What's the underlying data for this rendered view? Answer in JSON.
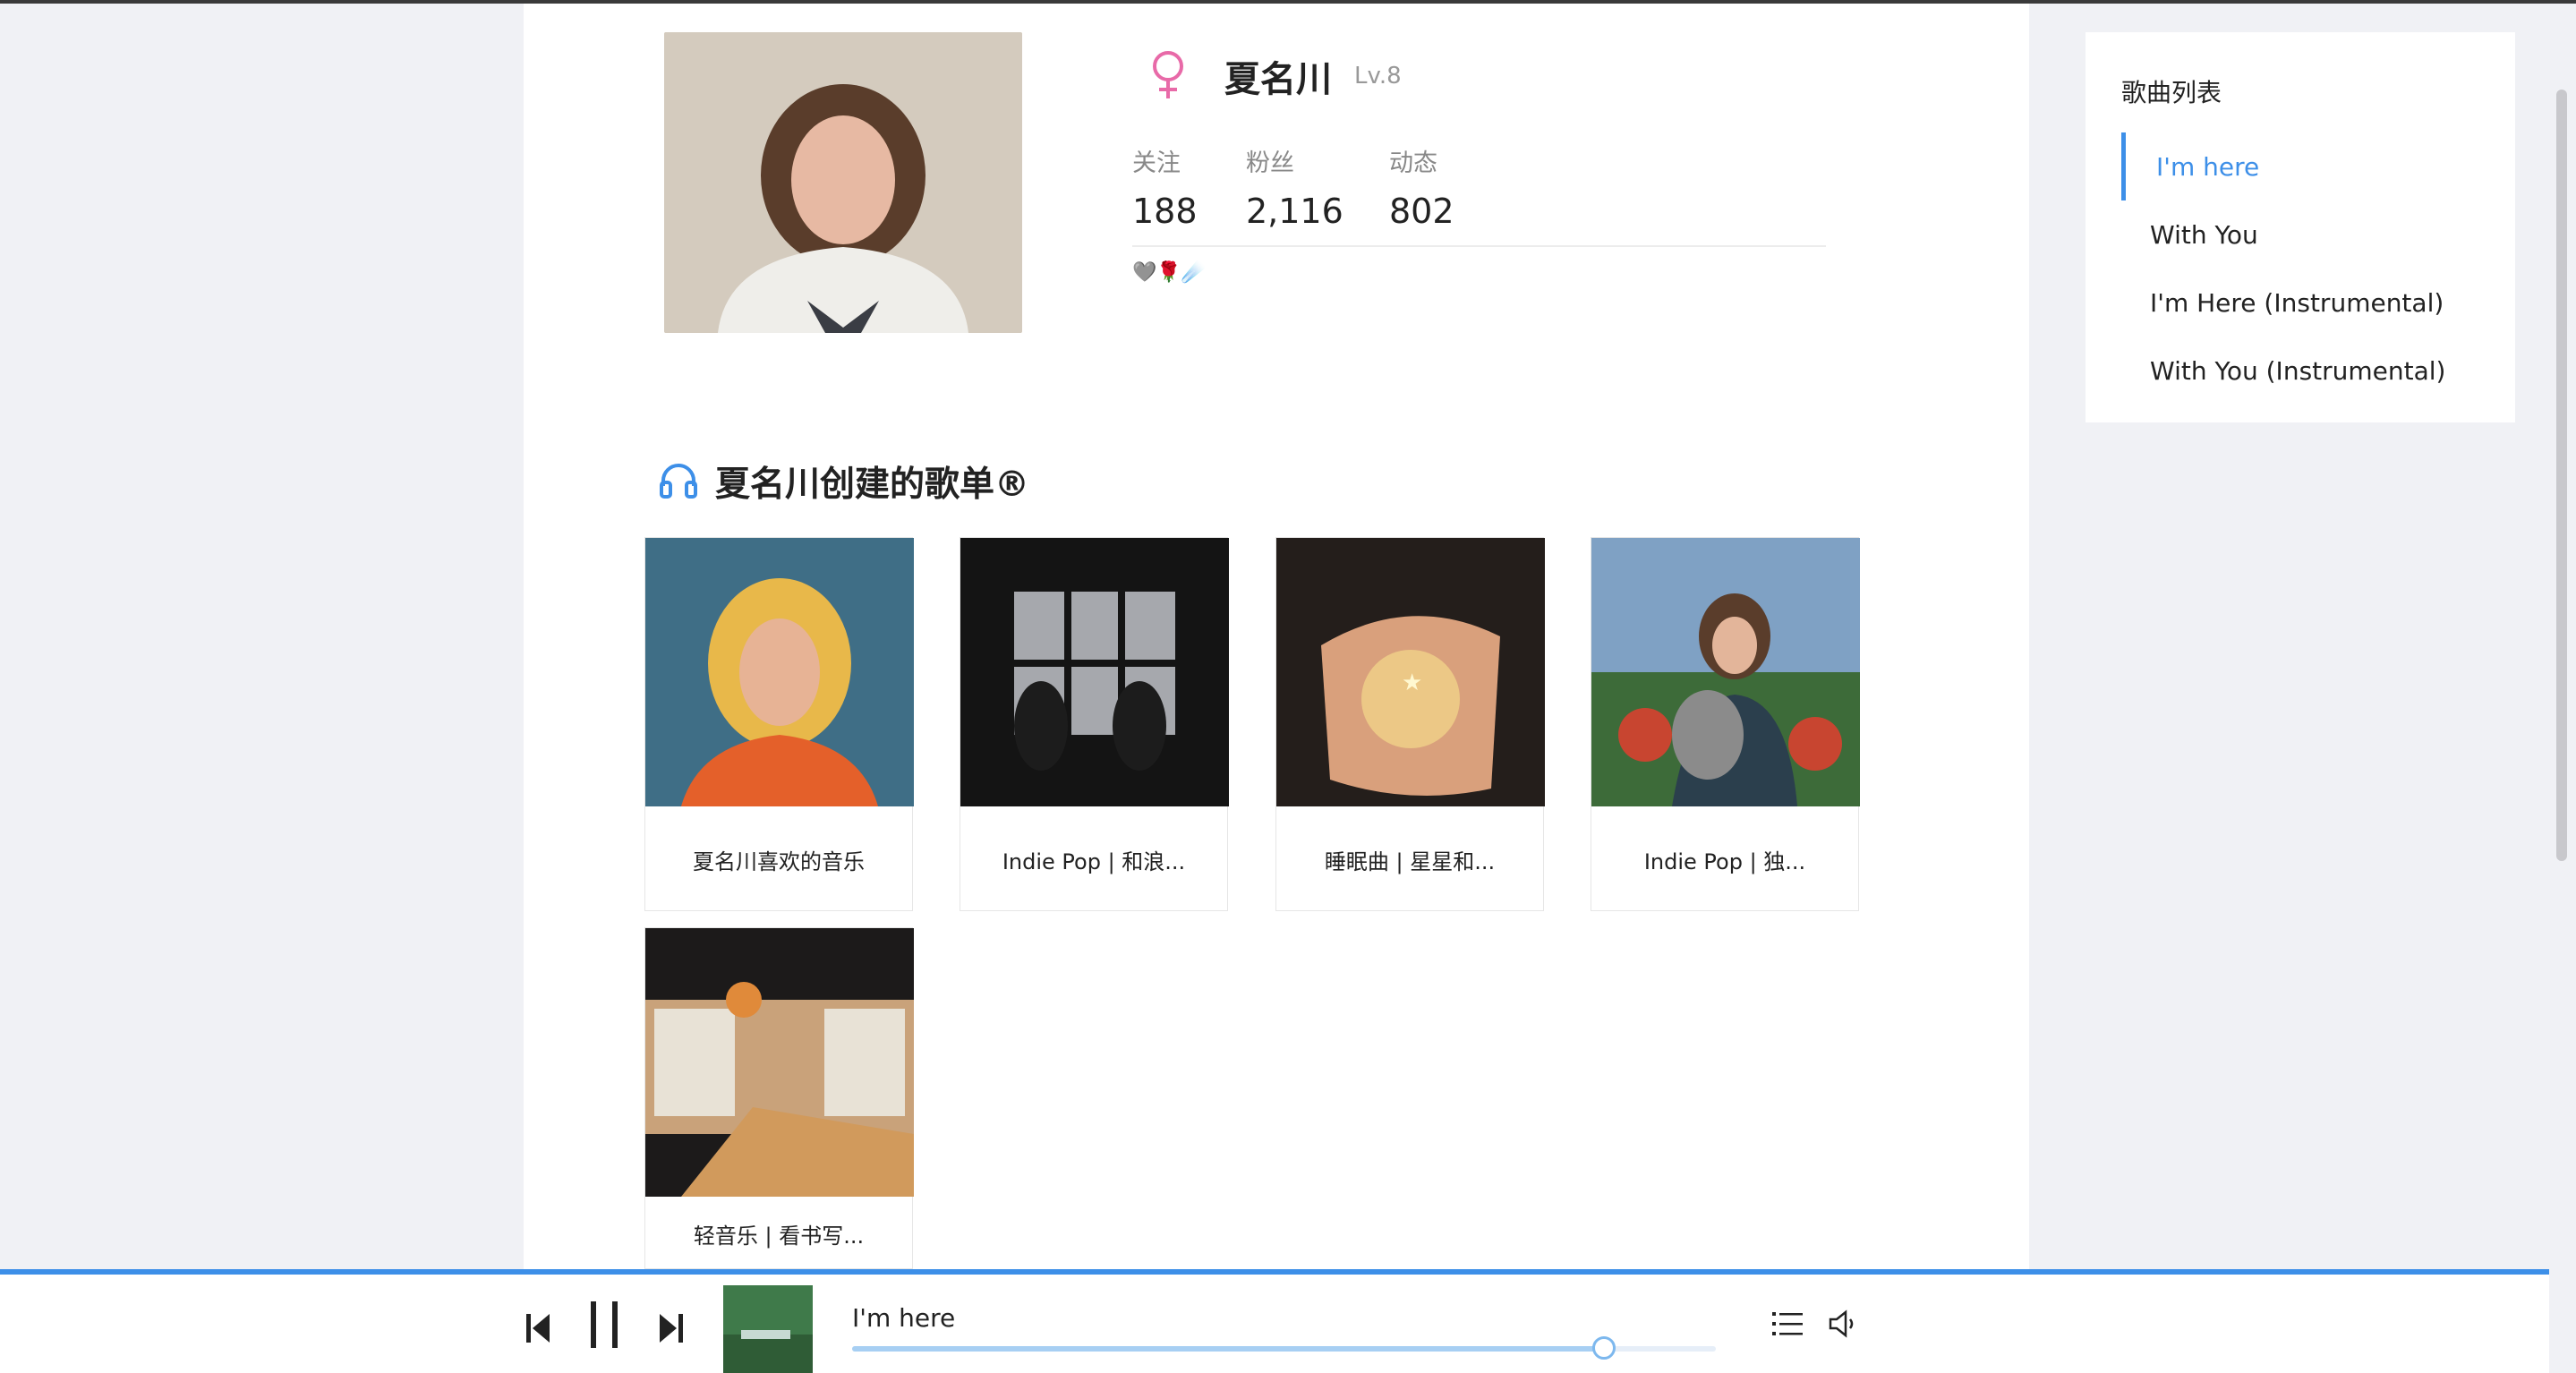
{
  "profile": {
    "name": "夏名川",
    "level": "Lv.8",
    "gender_icon": "female-icon",
    "stats": [
      {
        "label": "关注",
        "value": "188"
      },
      {
        "label": "粉丝",
        "value": "2,116"
      },
      {
        "label": "动态",
        "value": "802"
      }
    ],
    "signature_emoji": "🩶🌹☄️"
  },
  "playlists_section": {
    "title": "夏名川创建的歌单®",
    "icon": "headphones-icon",
    "cards": [
      {
        "title": "夏名川喜欢的音乐"
      },
      {
        "title": "Indie Pop | 和浪..."
      },
      {
        "title": "睡眠曲 | 星星和..."
      },
      {
        "title": "Indie Pop | 独..."
      },
      {
        "title": "轻音乐 | 看书写..."
      }
    ]
  },
  "song_list": {
    "title": "歌曲列表",
    "items": [
      "I'm here",
      "With You",
      "I'm Here (Instrumental)",
      "With You (Instrumental)"
    ],
    "active_index": 0
  },
  "player": {
    "track_title": "I'm here",
    "progress": 0.87,
    "accent": "#3d8fe8"
  }
}
